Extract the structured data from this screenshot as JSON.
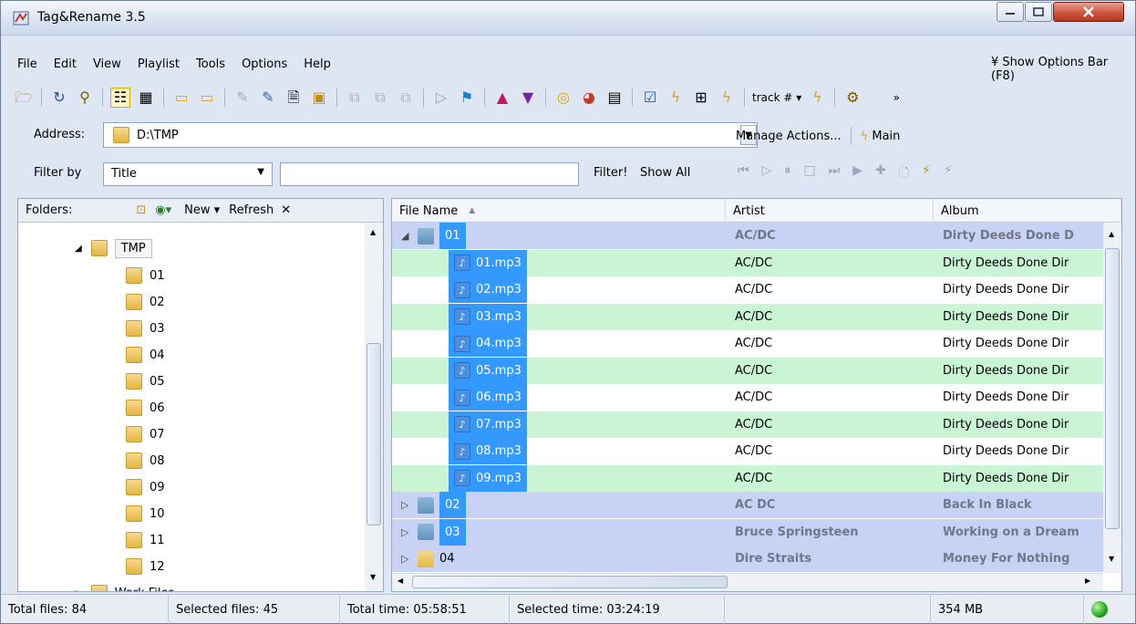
{
  "window": {
    "title": "Tag&Rename 3.5"
  },
  "menu": {
    "items": [
      "File",
      "Edit",
      "View",
      "Playlist",
      "Tools",
      "Options",
      "Help"
    ],
    "options_bar_label": "Show Options Bar (F8)"
  },
  "toolbar": {
    "track_label": "track #"
  },
  "address": {
    "label": "Address:",
    "value": "D:\\TMP"
  },
  "actions": {
    "manage": "Manage Actions...",
    "main": "Main"
  },
  "filter": {
    "label": "Filter by",
    "field": "Title",
    "filter_btn": "Filter!",
    "show_all_btn": "Show All"
  },
  "folders": {
    "label": "Folders:",
    "new_label": "New",
    "refresh_label": "Refresh",
    "root": "TMP",
    "children": [
      "01",
      "02",
      "03",
      "04",
      "05",
      "06",
      "07",
      "08",
      "09",
      "10",
      "11",
      "12"
    ],
    "partial": "Work Files"
  },
  "list": {
    "columns": [
      "File Name",
      "Artist",
      "Album"
    ],
    "rows": [
      {
        "kind": "group",
        "expanded": true,
        "name": "01",
        "artist": "AC/DC",
        "album": "Dirty Deeds Done D",
        "selected": true
      },
      {
        "kind": "file",
        "name": "01.mp3",
        "artist": "AC/DC",
        "album": "Dirty Deeds Done Dir"
      },
      {
        "kind": "file",
        "name": "02.mp3",
        "artist": "AC/DC",
        "album": "Dirty Deeds Done Dir"
      },
      {
        "kind": "file",
        "name": "03.mp3",
        "artist": "AC/DC",
        "album": "Dirty Deeds Done Dir"
      },
      {
        "kind": "file",
        "name": "04.mp3",
        "artist": "AC/DC",
        "album": "Dirty Deeds Done Dir"
      },
      {
        "kind": "file",
        "name": "05.mp3",
        "artist": "AC/DC",
        "album": "Dirty Deeds Done Dir"
      },
      {
        "kind": "file",
        "name": "06.mp3",
        "artist": "AC/DC",
        "album": "Dirty Deeds Done Dir"
      },
      {
        "kind": "file",
        "name": "07.mp3",
        "artist": "AC/DC",
        "album": "Dirty Deeds Done Dir"
      },
      {
        "kind": "file",
        "name": "08.mp3",
        "artist": "AC/DC",
        "album": "Dirty Deeds Done Dir"
      },
      {
        "kind": "file",
        "name": "09.mp3",
        "artist": "AC/DC",
        "album": "Dirty Deeds Done Dir"
      },
      {
        "kind": "group",
        "expanded": false,
        "name": "02",
        "artist": "AC DC",
        "album": "Back In Black",
        "selected": true
      },
      {
        "kind": "group",
        "expanded": false,
        "name": "03",
        "artist": "Bruce Springsteen",
        "album": "Working on a Dream",
        "selected": true
      },
      {
        "kind": "group",
        "expanded": false,
        "name": "04",
        "artist": "Dire Straits",
        "album": "Money For Nothing",
        "selected": false
      }
    ]
  },
  "status": {
    "total_files": "Total files: 84",
    "selected_files": "Selected files: 45",
    "total_time": "Total time: 05:58:51",
    "selected_time": "Selected time: 03:24:19",
    "size": "354 MB"
  }
}
